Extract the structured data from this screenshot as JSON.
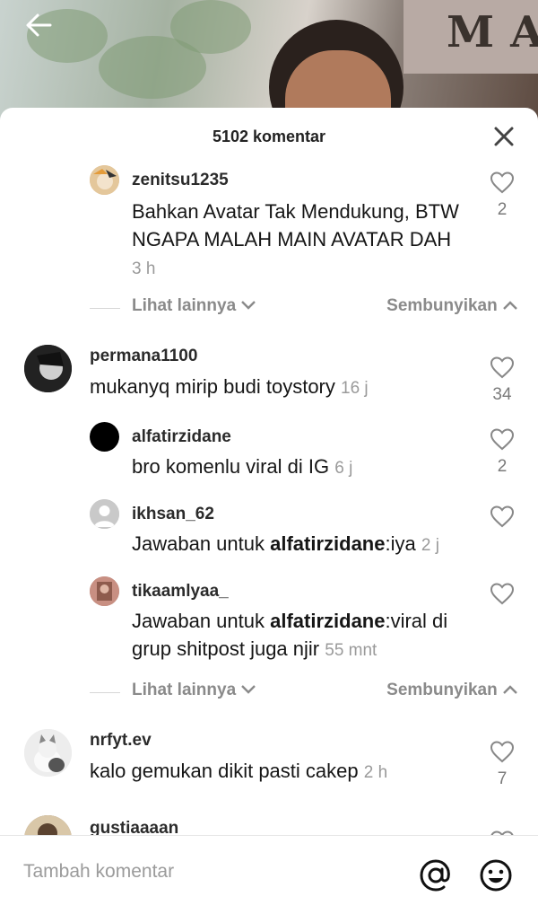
{
  "header": {
    "comment_count": "5102 komentar"
  },
  "comments": [
    {
      "username": "zenitsu1235",
      "text": "Bahkan Avatar Tak Mendukung, BTW NGAPA MALAH MAIN AVATAR DAH",
      "time": "3 h",
      "likes": "2",
      "avatar": "anime-avatar"
    },
    {
      "username": "permana1100",
      "text": "mukanyq mirip budi toystory",
      "time": "16 j",
      "likes": "34",
      "avatar": "dark-photo-avatar"
    },
    {
      "username": "alfatirzidane",
      "text": "bro komenlu viral di IG",
      "time": "6 j",
      "likes": "2",
      "avatar": "black-avatar"
    },
    {
      "username": "ikhsan_62",
      "prefix": "Jawaban untuk ",
      "mention": "alfatirzidane",
      "text": ":iya",
      "time": "2 j",
      "likes": "",
      "avatar": "default-user-avatar"
    },
    {
      "username": "tikaamlyaa_",
      "prefix": "Jawaban untuk ",
      "mention": "alfatirzidane",
      "text": ":viral di grup shitpost juga njir",
      "time": "55 mnt",
      "likes": "",
      "avatar": "photo-avatar"
    },
    {
      "username": "nrfyt.ev",
      "text": "kalo gemukan dikit pasti cakep",
      "time": "2 h",
      "likes": "7",
      "avatar": "cat-avatar"
    },
    {
      "username": "gustiaaaan",
      "text": "",
      "time": "",
      "likes": "",
      "avatar": "person-avatar"
    }
  ],
  "replies_controls": {
    "see_more": "Lihat lainnya",
    "hide": "Sembunyikan"
  },
  "composer": {
    "placeholder": "Tambah komentar"
  },
  "icons": {
    "back": "arrow-left-icon",
    "close": "close-icon",
    "like": "heart-outline-icon",
    "chevron_down": "chevron-down-icon",
    "chevron_up": "chevron-up-icon",
    "mention": "at-sign-icon",
    "emoji": "emoji-icon"
  },
  "colors": {
    "text": "#161616",
    "muted": "#9a9a9a",
    "divider": "#e6e6e6"
  }
}
